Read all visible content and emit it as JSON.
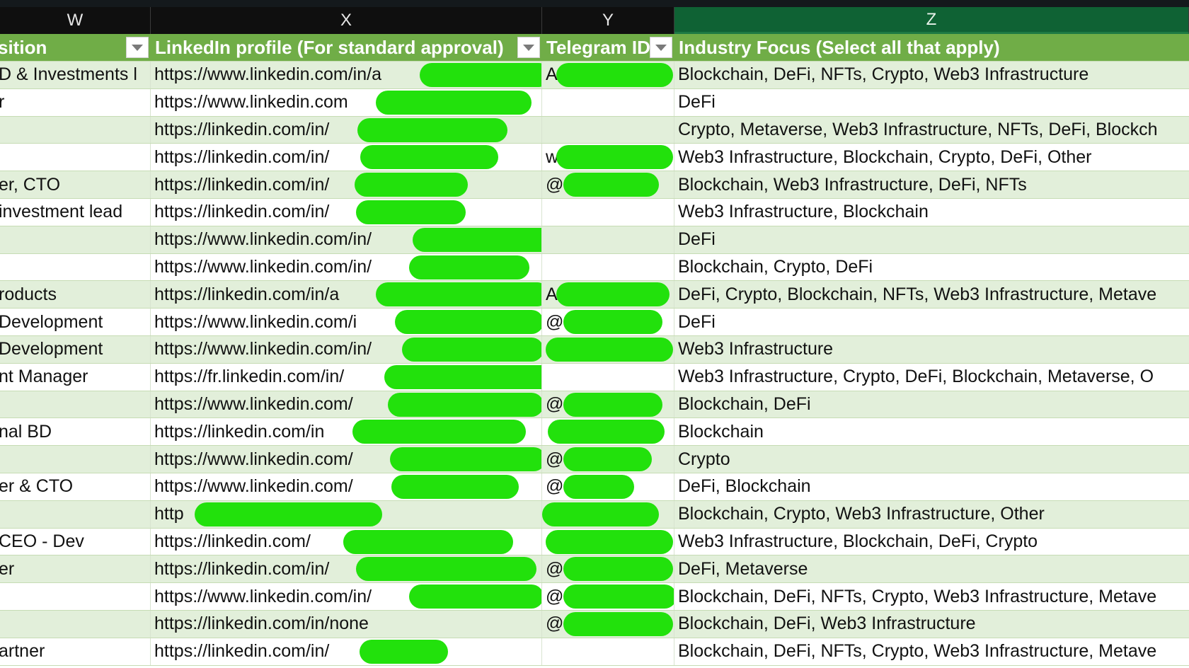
{
  "column_letters": [
    "W",
    "X",
    "Y",
    "Z"
  ],
  "selected_column": "Z",
  "headers": {
    "w": "sition",
    "x": "LinkedIn profile (For standard approval)",
    "y": "Telegram ID",
    "z": "Industry Focus (Select all that apply)"
  },
  "redaction_color": "#22e10c",
  "rows": [
    {
      "w": "D & Investments l",
      "x": "https://www.linkedin.com/in/a",
      "y": "A",
      "z": "Blockchain, DeFi, NFTs, Crypto, Web3 Infrastructure"
    },
    {
      "w": "r",
      "x": "https://www.linkedin.com",
      "y": "",
      "z": "DeFi"
    },
    {
      "w": "",
      "x": "https://linkedin.com/in/",
      "y": "",
      "z": "Crypto, Metaverse, Web3 Infrastructure, NFTs, DeFi, Blockch"
    },
    {
      "w": "",
      "x": "https://linkedin.com/in/",
      "y": "w",
      "z": "Web3 Infrastructure, Blockchain, Crypto, DeFi, Other"
    },
    {
      "w": "er, CTO",
      "x": "https://linkedin.com/in/",
      "y": "@",
      "z": "Blockchain, Web3 Infrastructure, DeFi, NFTs"
    },
    {
      "w": "investment lead",
      "x": "https://linkedin.com/in/",
      "y": "",
      "z": "Web3 Infrastructure, Blockchain"
    },
    {
      "w": "",
      "x": "https://www.linkedin.com/in/",
      "y": "",
      "z": "DeFi"
    },
    {
      "w": "",
      "x": "https://www.linkedin.com/in/",
      "y": "",
      "z": "Blockchain, Crypto, DeFi"
    },
    {
      "w": "roducts",
      "x": "https://linkedin.com/in/a",
      "y": "A",
      "z": "DeFi, Crypto, Blockchain, NFTs, Web3 Infrastructure, Metave"
    },
    {
      "w": "Development",
      "x": "https://www.linkedin.com/i",
      "y": "@",
      "z": "DeFi"
    },
    {
      "w": "Development",
      "x": "https://www.linkedin.com/in/",
      "y": "",
      "z": "Web3 Infrastructure"
    },
    {
      "w": "nt Manager",
      "x": "https://fr.linkedin.com/in/",
      "y": "",
      "z": "Web3 Infrastructure, Crypto, DeFi, Blockchain, Metaverse, O"
    },
    {
      "w": "",
      "x": "https://www.linkedin.com/",
      "y": "@",
      "z": "Blockchain, DeFi"
    },
    {
      "w": "nal BD",
      "x": "https://linkedin.com/in",
      "y": "",
      "z": "Blockchain"
    },
    {
      "w": "",
      "x": "https://www.linkedin.com/",
      "y": "@",
      "z": "Crypto"
    },
    {
      "w": "er & CTO",
      "x": "https://www.linkedin.com/",
      "y": "@",
      "z": "DeFi, Blockchain"
    },
    {
      "w": "",
      "x": "http",
      "y": "",
      "z": "Blockchain, Crypto, Web3 Infrastructure, Other"
    },
    {
      "w": " CEO - Dev",
      "x": "https://linkedin.com/",
      "y": "",
      "z": "Web3 Infrastructure, Blockchain, DeFi, Crypto"
    },
    {
      "w": "er",
      "x": "https://linkedin.com/in/",
      "y": "@",
      "z": "DeFi, Metaverse"
    },
    {
      "w": "",
      "x": "https://www.linkedin.com/in/",
      "y": "@",
      "z": "Blockchain, DeFi, NFTs, Crypto, Web3 Infrastructure, Metave"
    },
    {
      "w": "",
      "x": "https://linkedin.com/in/none",
      "y": "@",
      "z": "Blockchain, DeFi, Web3 Infrastructure"
    },
    {
      "w": "artner",
      "x": "https://linkedin.com/in/",
      "y": "",
      "z": "Blockchain, DeFi, NFTs, Crypto, Web3 Infrastructure, Metave"
    }
  ]
}
